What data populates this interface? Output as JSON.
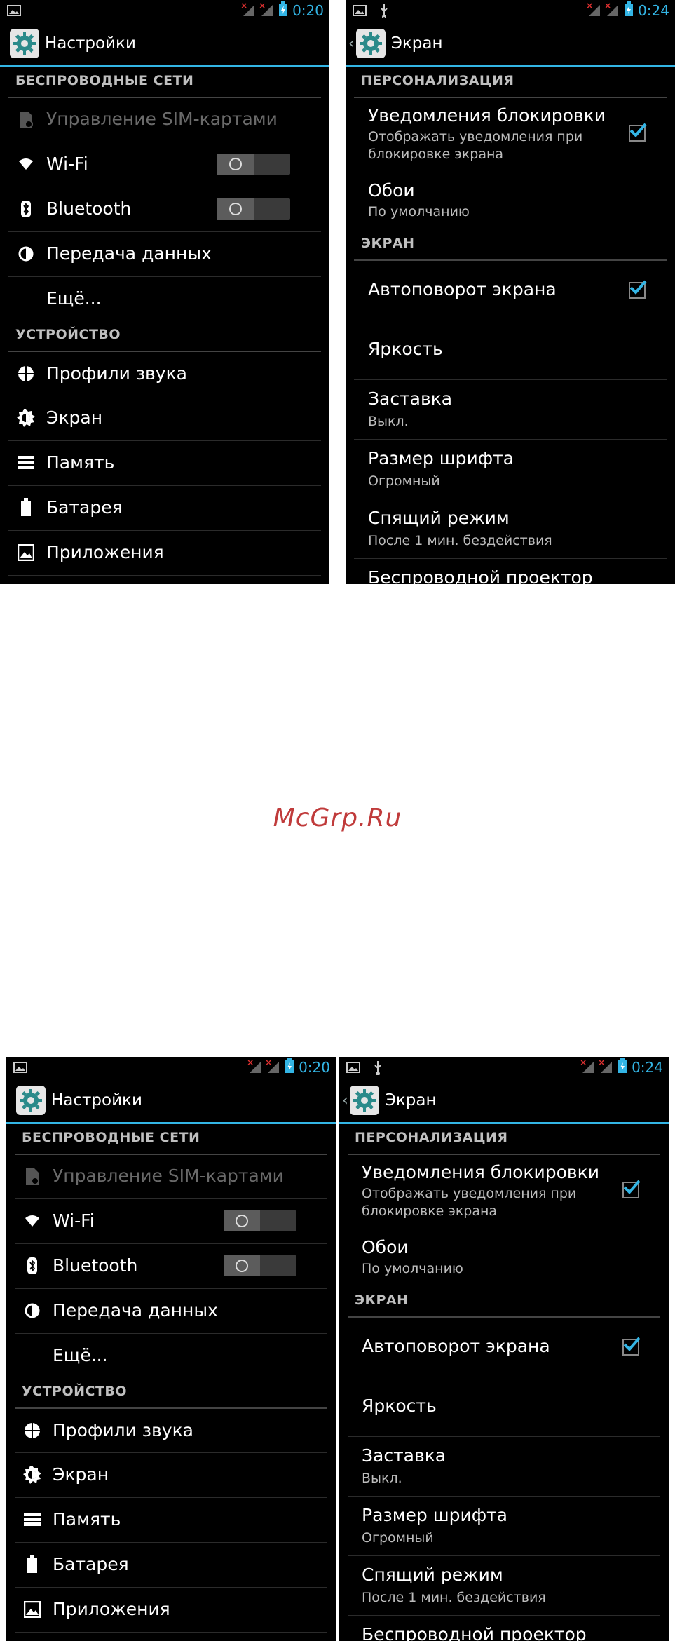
{
  "watermark": "McGrp.Ru",
  "left_panel": {
    "time": "0:20",
    "title": "Настройки",
    "section_wireless": "БЕСПРОВОДНЫЕ СЕТИ",
    "section_device": "УСТРОЙСТВО",
    "items": {
      "sim": "Управление SIM-картами",
      "wifi": "Wi-Fi",
      "bluetooth": "Bluetooth",
      "data": "Передача данных",
      "more": "Ещё...",
      "sound": "Профили звука",
      "display": "Экран",
      "memory": "Память",
      "battery": "Батарея",
      "apps": "Приложения"
    }
  },
  "right_panel": {
    "time": "0:24",
    "title": "Экран",
    "section_personalization": "ПЕРСОНАЛИЗАЦИЯ",
    "section_screen": "ЭКРАН",
    "items": {
      "lock_notif_title": "Уведомления блокировки",
      "lock_notif_sub1": "Отображать уведомления при",
      "lock_notif_sub2": "блокировке экрана",
      "wallpaper_title": "Обои",
      "wallpaper_sub": "По умолчанию",
      "autorotate_title": "Автоповорот экрана",
      "brightness_title": "Яркость",
      "screensaver_title": "Заставка",
      "screensaver_sub": "Выкл.",
      "fontsize_title": "Размер шрифта",
      "fontsize_sub": "Огромный",
      "sleep_title": "Спящий режим",
      "sleep_sub": "После 1 мин. бездействия",
      "wireless_display_title": "Беспроводной проектор"
    }
  },
  "colors": {
    "accent": "#33b5e5",
    "watermark": "#c03b3b",
    "background": "#000000"
  }
}
